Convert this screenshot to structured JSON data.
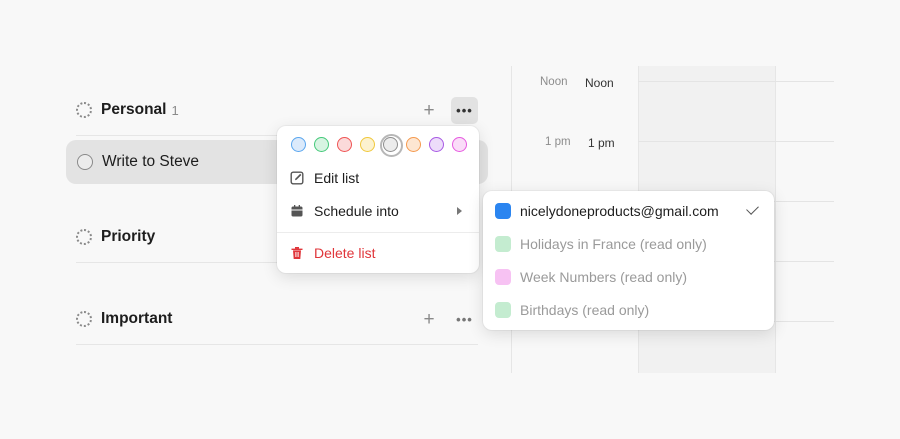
{
  "lists": [
    {
      "title": "Personal",
      "count": "1",
      "add_icon": "plus-icon",
      "more_icon": "ellipsis-icon"
    },
    {
      "title": "Priority"
    },
    {
      "title": "Important",
      "add_icon": "plus-icon",
      "more_icon": "ellipsis-icon"
    }
  ],
  "task": {
    "label": "Write to Steve",
    "completed": false
  },
  "calendar": {
    "times": [
      {
        "label": "Noon",
        "label2": "Noon"
      },
      {
        "label": "1 pm",
        "label2": "1 pm"
      }
    ]
  },
  "menu": {
    "swatch_colors": [
      {
        "name": "blue",
        "border": "#5aa6ee",
        "fill": "#dbeafb"
      },
      {
        "name": "green",
        "border": "#45c97a",
        "fill": "#d7f4e2"
      },
      {
        "name": "red",
        "border": "#ef5454",
        "fill": "#fbdada"
      },
      {
        "name": "yellow",
        "border": "#f0c83c",
        "fill": "#fcf2cf"
      },
      {
        "name": "gray",
        "border": "#8e8e8e",
        "fill": "#ececec",
        "selected": true
      },
      {
        "name": "orange",
        "border": "#f59a4e",
        "fill": "#fde6d2"
      },
      {
        "name": "purple",
        "border": "#a85ae4",
        "fill": "#eddcfa"
      },
      {
        "name": "pink",
        "border": "#e65ae0",
        "fill": "#fadcf8"
      }
    ],
    "edit_label": "Edit list",
    "schedule_label": "Schedule into",
    "delete_label": "Delete list"
  },
  "submenu": {
    "calendars": [
      {
        "name": "nicelydoneproducts@gmail.com",
        "color": "#2b85f0",
        "enabled": true,
        "checked": true
      },
      {
        "name": "Holidays in France (read only)",
        "color": "#c4ecd0",
        "enabled": false
      },
      {
        "name": "Week Numbers (read only)",
        "color": "#f7c2f3",
        "enabled": false
      },
      {
        "name": "Birthdays (read only)",
        "color": "#c4ecd0",
        "enabled": false
      }
    ]
  },
  "colors": {
    "accent_danger": "#e0353a",
    "task_highlight": "#e3e3e3"
  }
}
